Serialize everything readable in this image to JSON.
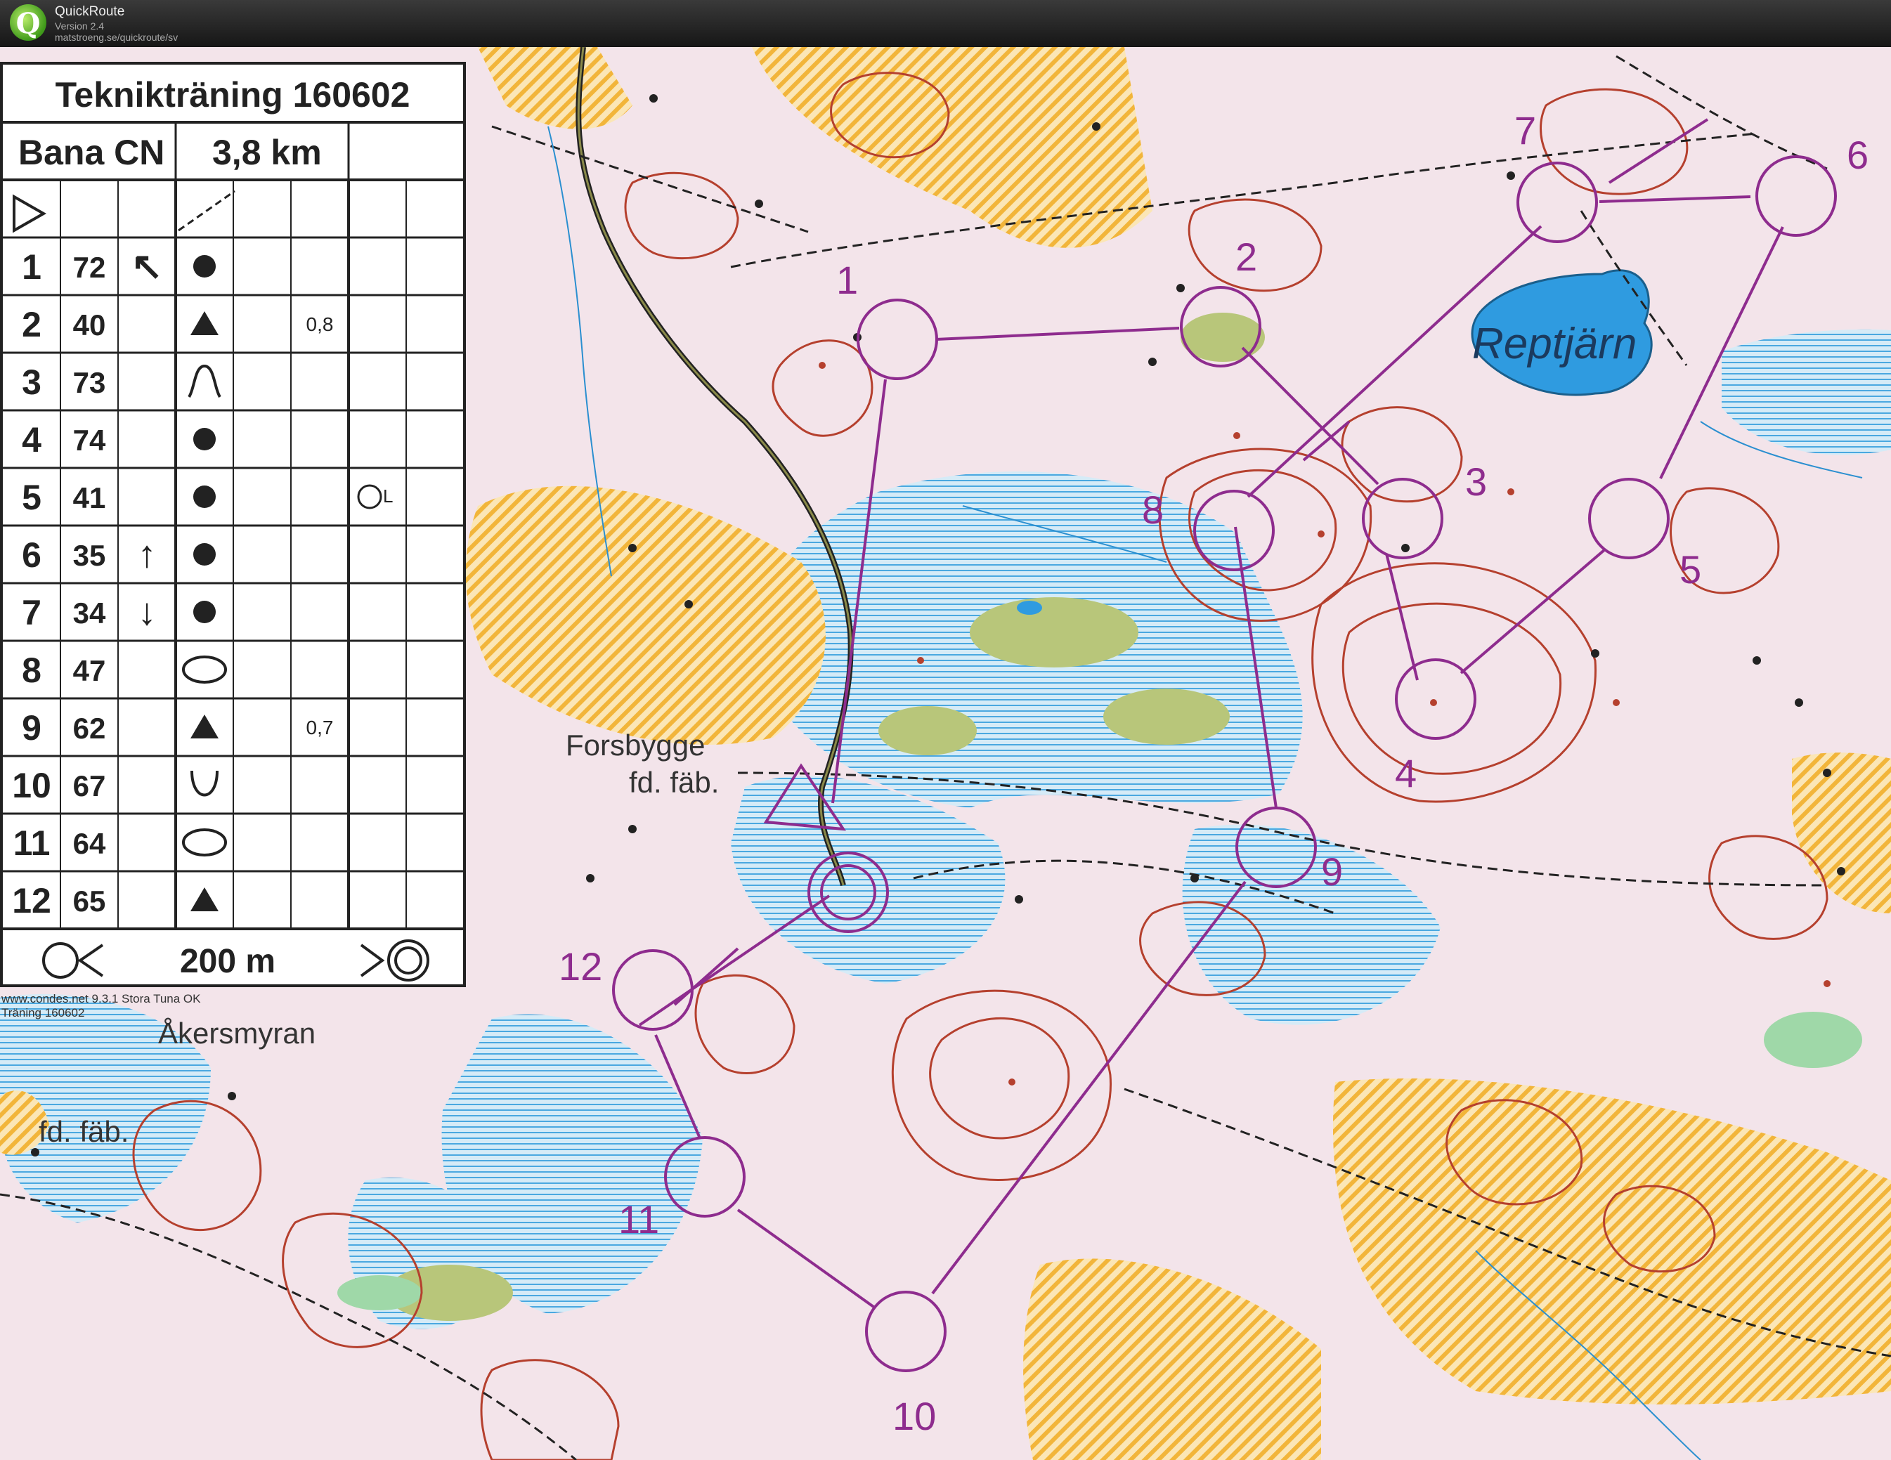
{
  "app": {
    "name": "QuickRoute",
    "version": "Version 2.4",
    "url": "matstroeng.se/quickroute/sv"
  },
  "card": {
    "title": "Teknikträning 160602",
    "course": "Bana CN",
    "length": "3,8 km",
    "controls": [
      {
        "num": "1",
        "code": "72",
        "dir": "↖",
        "symbol": "dot",
        "dim": ""
      },
      {
        "num": "2",
        "code": "40",
        "dir": "",
        "symbol": "triangle",
        "dim": "0,8"
      },
      {
        "num": "3",
        "code": "73",
        "dir": "",
        "symbol": "spur",
        "dim": ""
      },
      {
        "num": "4",
        "code": "74",
        "dir": "",
        "symbol": "dot",
        "dim": ""
      },
      {
        "num": "5",
        "code": "41",
        "dir": "",
        "symbol": "dot",
        "dim": "",
        "extra": "L"
      },
      {
        "num": "6",
        "code": "35",
        "dir": "↑",
        "symbol": "dot",
        "dim": ""
      },
      {
        "num": "7",
        "code": "34",
        "dir": "↓",
        "symbol": "dot",
        "dim": ""
      },
      {
        "num": "8",
        "code": "47",
        "dir": "",
        "symbol": "ellipse",
        "dim": ""
      },
      {
        "num": "9",
        "code": "62",
        "dir": "",
        "symbol": "triangle",
        "dim": "0,7"
      },
      {
        "num": "10",
        "code": "67",
        "dir": "",
        "symbol": "reentrant",
        "dim": ""
      },
      {
        "num": "11",
        "code": "64",
        "dir": "",
        "symbol": "ellipse",
        "dim": ""
      },
      {
        "num": "12",
        "code": "65",
        "dir": "",
        "symbol": "triangle",
        "dim": ""
      }
    ],
    "finish": "200 m"
  },
  "credit": {
    "line1": "www.condes.net 9.3.1 Stora Tuna OK",
    "line2": "Träning 160602"
  },
  "map": {
    "labels": {
      "lake": "Reptjärn",
      "settlement": "Forsbygge",
      "settlement_note": "fd. fäb.",
      "marsh": "Åkersmyran",
      "west_note": "fd. fäb."
    },
    "colors": {
      "course": "#8e2c8e",
      "water": "#5ab4e6",
      "contour": "#b5402e",
      "open": "#f2b53a",
      "background": "#f3e4ea"
    },
    "controls": [
      {
        "label": "1"
      },
      {
        "label": "2"
      },
      {
        "label": "3"
      },
      {
        "label": "4"
      },
      {
        "label": "5"
      },
      {
        "label": "6"
      },
      {
        "label": "7"
      },
      {
        "label": "8"
      },
      {
        "label": "9"
      },
      {
        "label": "10"
      },
      {
        "label": "11"
      },
      {
        "label": "12"
      }
    ]
  }
}
